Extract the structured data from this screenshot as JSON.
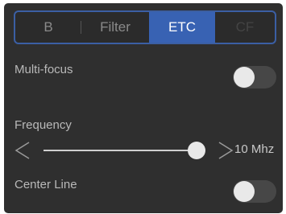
{
  "tabs": [
    {
      "label": "B",
      "state": "normal"
    },
    {
      "label": "Filter",
      "state": "normal"
    },
    {
      "label": "ETC",
      "state": "selected"
    },
    {
      "label": "CF",
      "state": "disabled"
    }
  ],
  "multi_focus": {
    "label": "Multi-focus",
    "enabled": false
  },
  "frequency": {
    "label": "Frequency",
    "value": "10 Mhz",
    "slider_fraction": 0.95,
    "prev_icon": "chevron-left-icon",
    "next_icon": "chevron-right-icon"
  },
  "center_line": {
    "label": "Center Line",
    "enabled": false
  },
  "colors": {
    "accent": "#3862b3",
    "tab_border": "#3b5fa4",
    "panel_bg": "#2f2f2f",
    "toggle_track": "#474747",
    "toggle_knob": "#e9e9e9"
  }
}
